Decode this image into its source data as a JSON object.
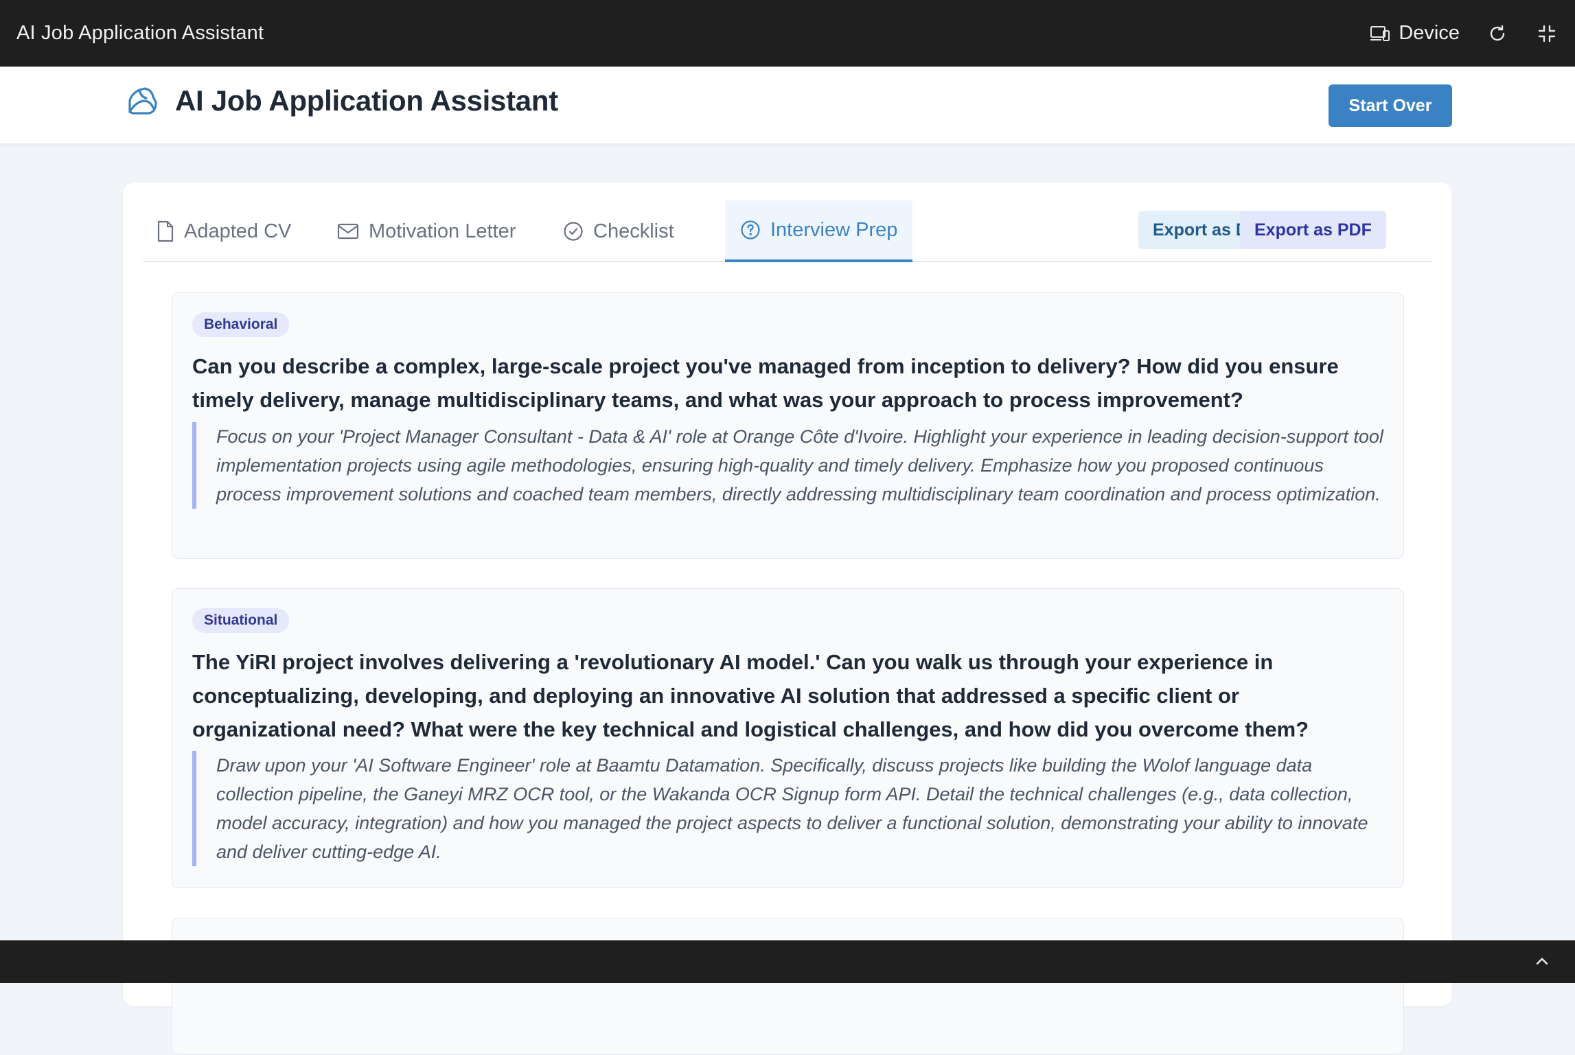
{
  "window": {
    "title": "AI Job Application Assistant",
    "device_label": "Device",
    "icons": [
      "device-icon",
      "refresh-icon",
      "collapse-icon"
    ]
  },
  "header": {
    "title": "AI Job Application Assistant",
    "logo_icon": "logo-icon",
    "start_over_label": "Start Over"
  },
  "tabs": [
    {
      "label": "Adapted CV",
      "icon": "document-icon",
      "active": false
    },
    {
      "label": "Motivation Letter",
      "icon": "mail-icon",
      "active": false
    },
    {
      "label": "Checklist",
      "icon": "check-circle-icon",
      "active": false
    },
    {
      "label": "Interview Prep",
      "icon": "question-circle-icon",
      "active": true
    }
  ],
  "export": {
    "docx_label": "Export as DOCX",
    "pdf_label": "Export as PDF"
  },
  "questions": [
    {
      "category": "Behavioral",
      "question": "Can you describe a complex, large-scale project you've managed from inception to delivery? How did you ensure timely delivery, manage multidisciplinary teams, and what was your approach to process improvement?",
      "tip": "Focus on your 'Project Manager Consultant - Data & AI' role at Orange Côte d'Ivoire. Highlight your experience in leading decision-support tool implementation projects using agile methodologies, ensuring high-quality and timely delivery. Emphasize how you proposed continuous process improvement solutions and coached team members, directly addressing multidisciplinary team coordination and process optimization."
    },
    {
      "category": "Situational",
      "question": "The YiRI project involves delivering a 'revolutionary AI model.' Can you walk us through your experience in conceptualizing, developing, and deploying an innovative AI solution that addressed a specific client or organizational need? What were the key technical and logistical challenges, and how did you overcome them?",
      "tip": "Draw upon your 'AI Software Engineer' role at Baamtu Datamation. Specifically, discuss projects like building the Wolof language data collection pipeline, the Ganeyi MRZ OCR tool, or the Wakanda OCR Signup form API. Detail the technical challenges (e.g., data collection, model accuracy, integration) and how you managed the project aspects to deliver a functional solution, demonstrating your ability to innovate and deliver cutting-edge AI."
    }
  ],
  "colors": {
    "accent": "#3b82c4",
    "topbar": "#1f1f1f",
    "badge_bg": "#e6e8fb",
    "tip_border": "#a5b4f3"
  }
}
